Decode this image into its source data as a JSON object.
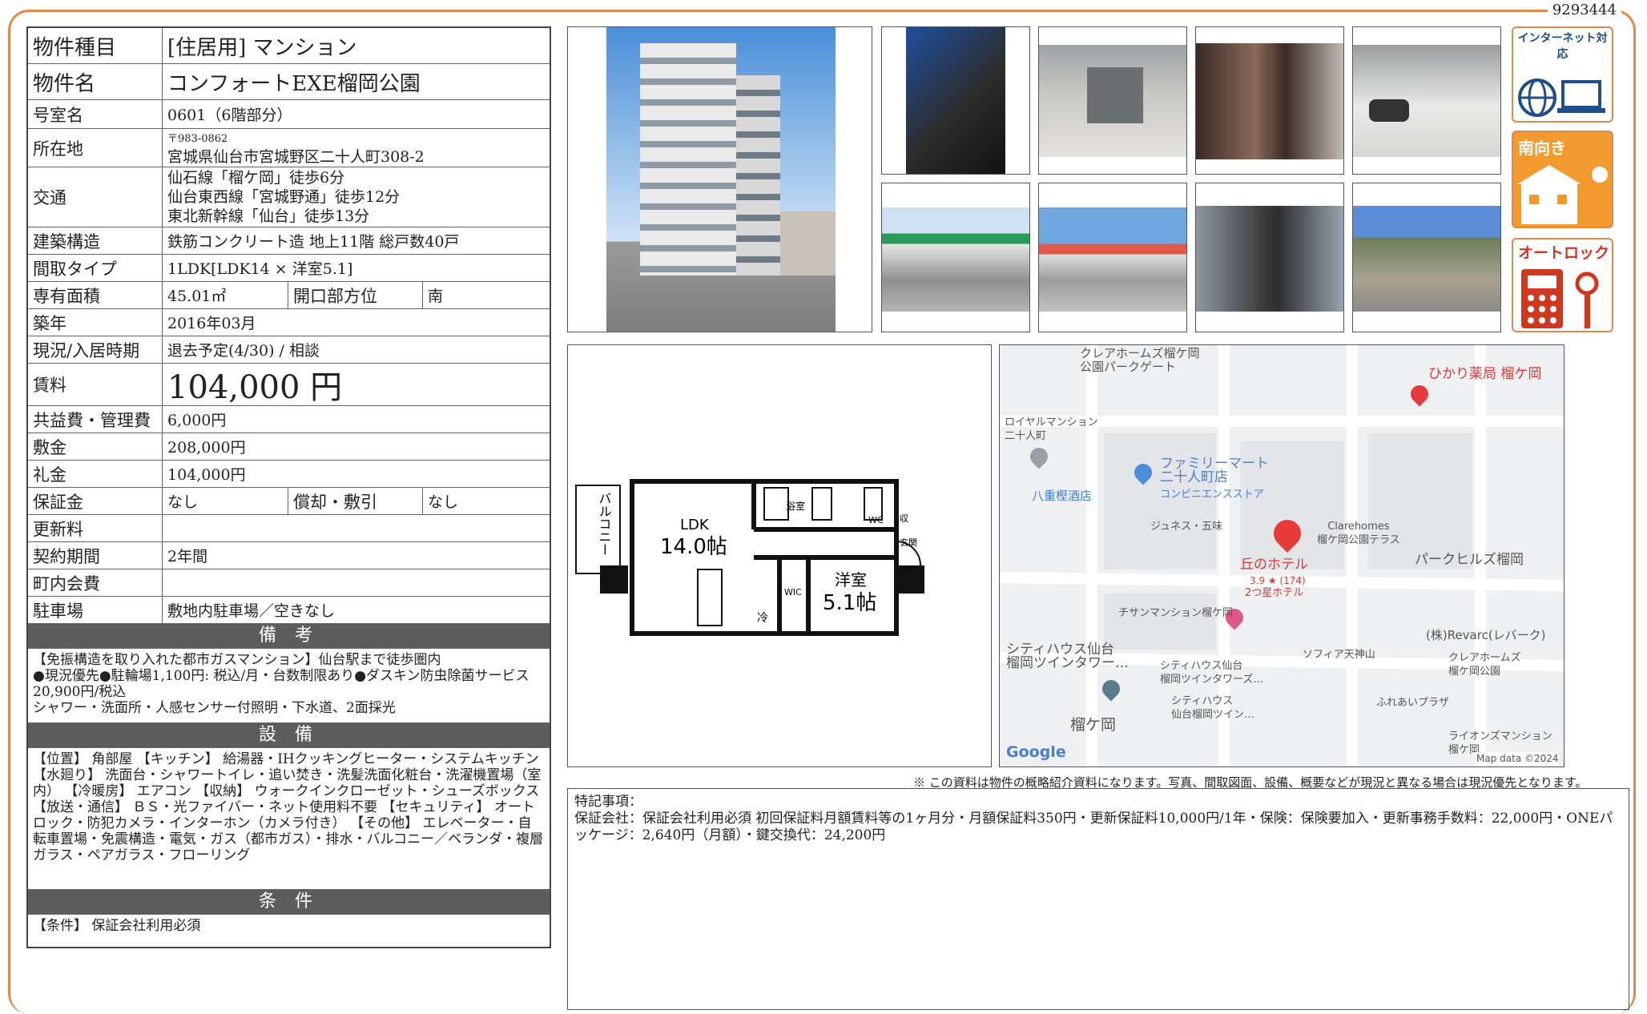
{
  "doc_id": "9293444",
  "table": {
    "type_label": "物件種目",
    "type_value": "[住居用]  マンション",
    "name_label": "物件名",
    "name_value": "コンフォートEXE榴岡公園",
    "room_label": "号室名",
    "room_value": "0601（6階部分）",
    "address_label": "所在地",
    "zip": "〒983-0862",
    "address": "宮城県仙台市宮城野区二十人町308-2",
    "access_label": "交通",
    "access": [
      "仙石線「榴ケ岡」徒歩6分",
      "仙台東西線「宮城野通」徒歩12分",
      "東北新幹線「仙台」徒歩13分"
    ],
    "structure_label": "建築構造",
    "structure_value": "鉄筋コンクリート造 地上11階 総戸数40戸",
    "layout_label": "間取タイプ",
    "layout_value": "1LDK[LDK14 × 洋室5.1]",
    "area_label": "専有面積",
    "area_value": "45.01㎡",
    "direction_label": "開口部方位",
    "direction_value": "南",
    "built_label": "築年",
    "built_value": "2016年03月",
    "status_label": "現況/入居時期",
    "status_value": "退去予定(4/30) / 相談",
    "rent_label": "賃料",
    "rent_value": "104,000 円",
    "fee_label": "共益費・管理費",
    "fee_value": "6,000円",
    "deposit_label": "敷金",
    "deposit_value": "208,000円",
    "key_label": "礼金",
    "key_value": "104,000円",
    "guarantee_label": "保証金",
    "guarantee_value": "なし",
    "amort_label": "償却・敷引",
    "amort_value": "なし",
    "renewal_label": "更新料",
    "renewal_value": "",
    "contract_label": "契約期間",
    "contract_value": "2年間",
    "town_label": "町内会費",
    "town_value": "",
    "parking_label": "駐車場",
    "parking_value": "敷地内駐車場／空きなし",
    "remarks_head": "備 考",
    "remarks": "【免振構造を取り入れた都市ガスマンション】仙台駅まで徒歩圏内\n●現況優先●駐輪場1,100円: 税込/月・台数制限あり●ダスキン防虫除菌サービス20,900円/税込\nシャワー・洗面所・人感センサー付照明・下水道、2面採光",
    "equip_head": "設 備",
    "equip": "【位置】 角部屋 【キッチン】 給湯器・IHクッキングヒーター・システムキッチン 【水廻り】 洗面台・シャワートイレ・追い焚き・洗髪洗面化粧台・洗濯機置場（室内） 【冷暖房】 エアコン 【収納】 ウォークインクローゼット・シューズボックス 【放送・通信】 ＢＳ・光ファイバー・ネット使用料不要 【セキュリティ】 オートロック・防犯カメラ・インターホン（カメラ付き） 【その他】 エレベーター・自転車置場・免震構造・電気・ガス（都市ガス）・排水・バルコニー／ベランダ・複層ガラス・ペアガラス・フローリング",
    "cond_head": "条 件",
    "cond": "【条件】 保証会社利用必須"
  },
  "icons": {
    "internet": "インターネット対応",
    "south": "南向き",
    "autolock": "オートロック"
  },
  "floorplan": {
    "balcony": "バルコニー",
    "ldk": "LDK",
    "ldk_size": "14.0帖",
    "yoshitsu": "洋室",
    "yoshitsu_size": "5.1帖",
    "bath": "浴室",
    "wc": "WC",
    "wic": "WIC",
    "fridge": "冷",
    "entrance": "玄関",
    "shoe": "収"
  },
  "map": {
    "labels": [
      "クレアホームズ榴ケ岡\n公園パークゲート",
      "ひかり薬局 榴ケ岡",
      "ロイヤルマンション\n二十人町",
      "ファミリーマート\n二十人町店",
      "コンビニエンスストア",
      "八重樫酒店",
      "ジュネス・五味",
      "Clarehomes\n榴ケ岡公園テラス",
      "丘のホテル",
      "3.9 ★ (174)",
      "2つ星ホテル",
      "パークヒルズ榴岡",
      "チサンマンション榴ケ岡",
      "ソフィア天神山",
      "(株)Revarc(レバーク)",
      "シティハウス仙台\n榴岡ツインタワー…",
      "シティハウス仙台\n榴岡ツインタワーズ…",
      "クレアホームズ\n榴ケ岡公園",
      "シティハウス\n仙台榴岡ツイン…",
      "ふれあいプラザ",
      "榴ケ岡",
      "ライオンズマンション\n榴ケ岡",
      "Google",
      "Map data ©2024"
    ]
  },
  "disclaimer": "※ この資料は物件の概略紹介資料になります。写真、間取図面、設備、概要などが現況と異なる場合は現況優先となります。",
  "special_title": "特記事項：",
  "special_body": "保証会社：保証会社利用必須 初回保証料月額賃料等の1ヶ月分・月額保証料350円・更新保証料10,000円/1年・保険：保険要加入・更新事務手数料：22,000円・ONEパッケージ：2,640円（月額）・鍵交換代：24,200円",
  "colors": {
    "frame": "#e08a4a",
    "header": "#5d5d5d",
    "pin": "#e63b3b"
  }
}
